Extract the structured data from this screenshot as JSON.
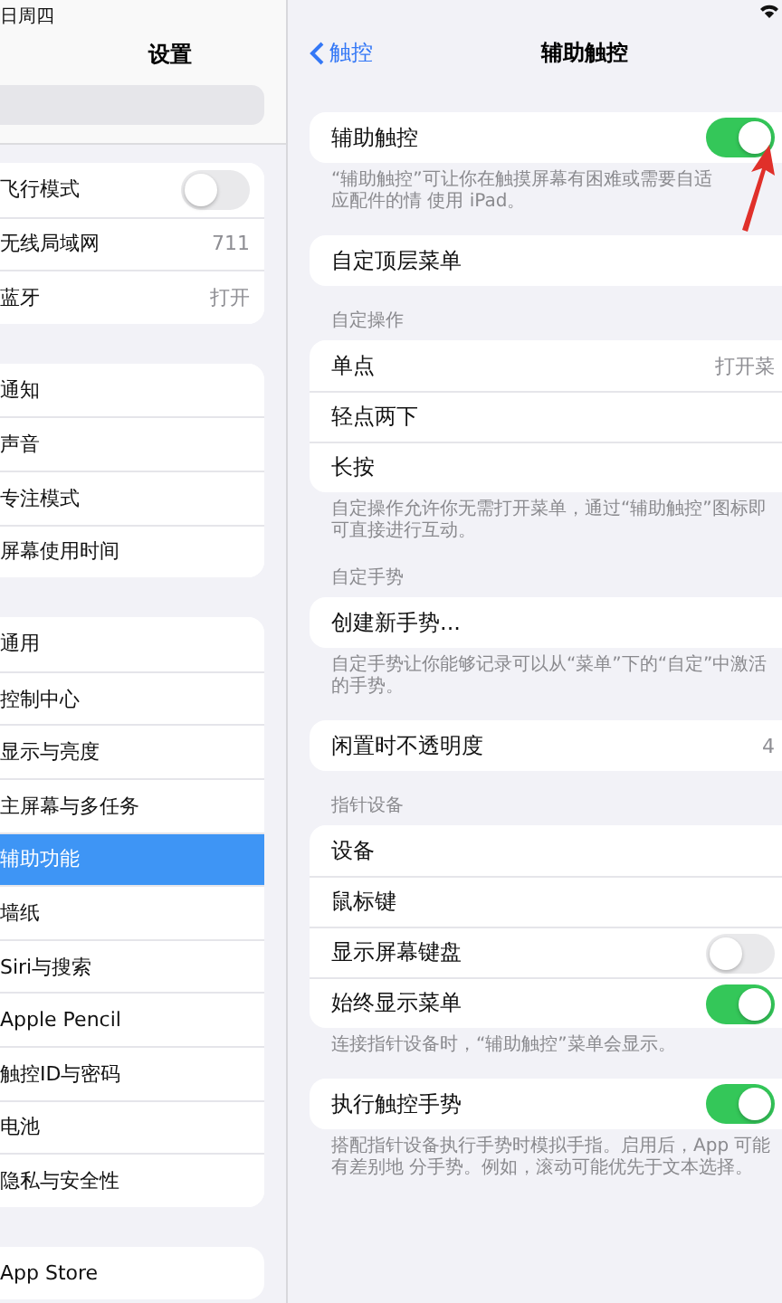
{
  "status_bar": {
    "date": "日周四"
  },
  "sidebar": {
    "title": "设置",
    "groups": [
      [
        {
          "label": "飞行模式",
          "kind": "toggle",
          "on": false,
          "selected": false
        },
        {
          "label": "无线局域网",
          "kind": "value",
          "value": "711",
          "selected": false
        },
        {
          "label": "蓝牙",
          "kind": "value",
          "value": "打开",
          "selected": false
        }
      ],
      [
        {
          "label": "通知",
          "kind": "plain",
          "selected": false
        },
        {
          "label": "声音",
          "kind": "plain",
          "selected": false
        },
        {
          "label": "专注模式",
          "kind": "plain",
          "selected": false
        },
        {
          "label": "屏幕使用时间",
          "kind": "plain",
          "selected": false
        }
      ],
      [
        {
          "label": "通用",
          "kind": "plain",
          "selected": false
        },
        {
          "label": "控制中心",
          "kind": "plain",
          "selected": false
        },
        {
          "label": "显示与亮度",
          "kind": "plain",
          "selected": false
        },
        {
          "label": "主屏幕与多任务",
          "kind": "plain",
          "selected": false
        },
        {
          "label": "辅助功能",
          "kind": "plain",
          "selected": true
        },
        {
          "label": "墙纸",
          "kind": "plain",
          "selected": false
        },
        {
          "label": "Siri与搜索",
          "kind": "plain",
          "selected": false
        },
        {
          "label": "Apple Pencil",
          "kind": "plain",
          "selected": false
        },
        {
          "label": "触控ID与密码",
          "kind": "plain",
          "selected": false
        },
        {
          "label": "电池",
          "kind": "plain",
          "selected": false
        },
        {
          "label": "隐私与安全性",
          "kind": "plain",
          "selected": false
        }
      ],
      [
        {
          "label": "App Store",
          "kind": "plain",
          "selected": false
        }
      ]
    ]
  },
  "detail": {
    "back": "触控",
    "title": "辅助触控",
    "sections": [
      {
        "rows": [
          {
            "label": "辅助触控",
            "kind": "toggle",
            "on": true
          }
        ],
        "footer": "“辅助触控”可让你在触摸屏幕有困难或需要自适应配件的情 使用 iPad。"
      },
      {
        "rows": [
          {
            "label": "自定顶层菜单",
            "kind": "plain"
          }
        ]
      },
      {
        "header": "自定操作",
        "rows": [
          {
            "label": "单点",
            "kind": "value",
            "value": "打开菜"
          },
          {
            "label": "轻点两下",
            "kind": "plain"
          },
          {
            "label": "长按",
            "kind": "plain"
          }
        ],
        "footer": "自定操作允许你无需打开菜单，通过“辅助触控”图标即可直接进行互动。"
      },
      {
        "header": "自定手势",
        "rows": [
          {
            "label": "创建新手势...",
            "kind": "plain"
          }
        ],
        "footer": "自定手势让你能够记录可以从“菜单”下的“自定”中激活的手势。"
      },
      {
        "rows": [
          {
            "label": "闲置时不透明度",
            "kind": "value",
            "value": "4"
          }
        ]
      },
      {
        "header": "指针设备",
        "rows": [
          {
            "label": "设备",
            "kind": "plain"
          },
          {
            "label": "鼠标键",
            "kind": "plain"
          },
          {
            "label": "显示屏幕键盘",
            "kind": "toggle",
            "on": false
          },
          {
            "label": "始终显示菜单",
            "kind": "toggle",
            "on": true
          }
        ],
        "footer": "连接指针设备时，“辅助触控”菜单会显示。"
      },
      {
        "rows": [
          {
            "label": "执行触控手势",
            "kind": "toggle",
            "on": true
          }
        ],
        "footer": "搭配指针设备执行手势时模拟手指。启用后，App 可能有差别地 分手势。例如，滚动可能优先于文本选择。"
      }
    ]
  }
}
